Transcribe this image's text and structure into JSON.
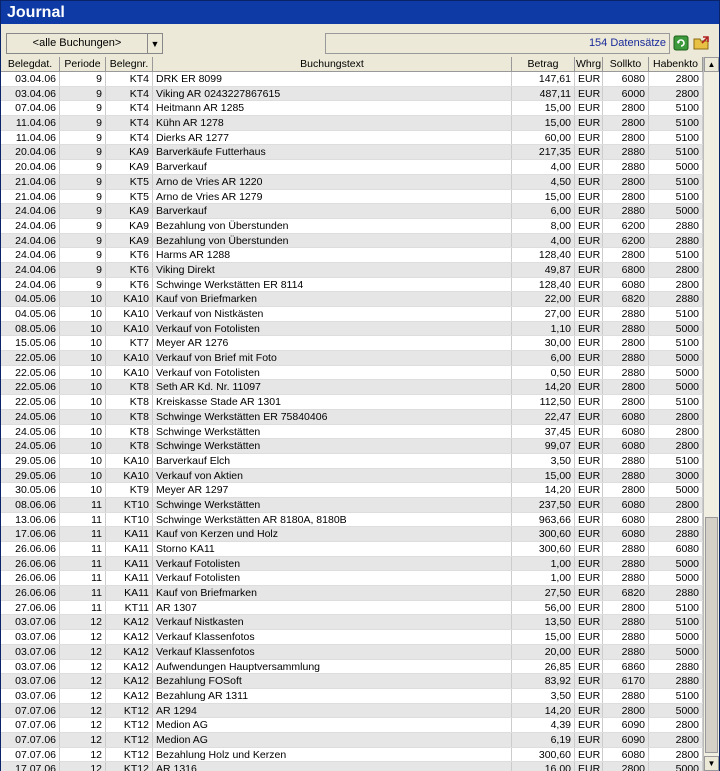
{
  "window": {
    "title": "Journal"
  },
  "toolbar": {
    "filter_value": "<alle Buchungen>",
    "record_count": "154 Datensätze",
    "refresh_icon": "refresh-icon",
    "export_icon": "folder-export-icon"
  },
  "table": {
    "columns": [
      "Belegdat.",
      "Periode",
      "Belegnr.",
      "Buchungstext",
      "Betrag",
      "Whrg",
      "Sollkto",
      "Habenkto"
    ],
    "rows": [
      [
        "03.04.06",
        "9",
        "KT4",
        "DRK ER 8099",
        "147,61",
        "EUR",
        "6080",
        "2800"
      ],
      [
        "03.04.06",
        "9",
        "KT4",
        "Viking AR 0243227867615",
        "487,11",
        "EUR",
        "6000",
        "2800"
      ],
      [
        "07.04.06",
        "9",
        "KT4",
        "Heitmann AR 1285",
        "15,00",
        "EUR",
        "2800",
        "5100"
      ],
      [
        "11.04.06",
        "9",
        "KT4",
        "Kühn AR 1278",
        "15,00",
        "EUR",
        "2800",
        "5100"
      ],
      [
        "11.04.06",
        "9",
        "KT4",
        "Dierks AR 1277",
        "60,00",
        "EUR",
        "2800",
        "5100"
      ],
      [
        "20.04.06",
        "9",
        "KA9",
        "Barverkäufe Futterhaus",
        "217,35",
        "EUR",
        "2880",
        "5100"
      ],
      [
        "20.04.06",
        "9",
        "KA9",
        "Barverkauf",
        "4,00",
        "EUR",
        "2880",
        "5000"
      ],
      [
        "21.04.06",
        "9",
        "KT5",
        "Arno de Vries AR 1220",
        "4,50",
        "EUR",
        "2800",
        "5100"
      ],
      [
        "21.04.06",
        "9",
        "KT5",
        "Arno de Vries AR 1279",
        "15,00",
        "EUR",
        "2800",
        "5100"
      ],
      [
        "24.04.06",
        "9",
        "KA9",
        "Barverkauf",
        "6,00",
        "EUR",
        "2880",
        "5000"
      ],
      [
        "24.04.06",
        "9",
        "KA9",
        "Bezahlung von Überstunden",
        "8,00",
        "EUR",
        "6200",
        "2880"
      ],
      [
        "24.04.06",
        "9",
        "KA9",
        "Bezahlung von Überstunden",
        "4,00",
        "EUR",
        "6200",
        "2880"
      ],
      [
        "24.04.06",
        "9",
        "KT6",
        "Harms AR 1288",
        "128,40",
        "EUR",
        "2800",
        "5100"
      ],
      [
        "24.04.06",
        "9",
        "KT6",
        "Viking Direkt",
        "49,87",
        "EUR",
        "6800",
        "2800"
      ],
      [
        "24.04.06",
        "9",
        "KT6",
        "Schwinge Werkstätten ER 8114",
        "128,40",
        "EUR",
        "6080",
        "2800"
      ],
      [
        "04.05.06",
        "10",
        "KA10",
        "Kauf von Briefmarken",
        "22,00",
        "EUR",
        "6820",
        "2880"
      ],
      [
        "04.05.06",
        "10",
        "KA10",
        "Verkauf von Nistkästen",
        "27,00",
        "EUR",
        "2880",
        "5100"
      ],
      [
        "08.05.06",
        "10",
        "KA10",
        "Verkauf von Fotolisten",
        "1,10",
        "EUR",
        "2880",
        "5000"
      ],
      [
        "15.05.06",
        "10",
        "KT7",
        "Meyer AR 1276",
        "30,00",
        "EUR",
        "2800",
        "5100"
      ],
      [
        "22.05.06",
        "10",
        "KA10",
        "Verkauf von Brief mit Foto",
        "6,00",
        "EUR",
        "2880",
        "5000"
      ],
      [
        "22.05.06",
        "10",
        "KA10",
        "Verkauf von Fotolisten",
        "0,50",
        "EUR",
        "2880",
        "5000"
      ],
      [
        "22.05.06",
        "10",
        "KT8",
        "Seth AR Kd. Nr. 11097",
        "14,20",
        "EUR",
        "2800",
        "5000"
      ],
      [
        "22.05.06",
        "10",
        "KT8",
        "Kreiskasse Stade AR 1301",
        "112,50",
        "EUR",
        "2800",
        "5100"
      ],
      [
        "24.05.06",
        "10",
        "KT8",
        "Schwinge Werkstätten ER 75840406",
        "22,47",
        "EUR",
        "6080",
        "2800"
      ],
      [
        "24.05.06",
        "10",
        "KT8",
        "Schwinge Werkstätten",
        "37,45",
        "EUR",
        "6080",
        "2800"
      ],
      [
        "24.05.06",
        "10",
        "KT8",
        "Schwinge Werkstätten",
        "99,07",
        "EUR",
        "6080",
        "2800"
      ],
      [
        "29.05.06",
        "10",
        "KA10",
        "Barverkauf Elch",
        "3,50",
        "EUR",
        "2880",
        "5100"
      ],
      [
        "29.05.06",
        "10",
        "KA10",
        "Verkauf von Aktien",
        "15,00",
        "EUR",
        "2880",
        "3000"
      ],
      [
        "30.05.06",
        "10",
        "KT9",
        "Meyer AR 1297",
        "14,20",
        "EUR",
        "2800",
        "5000"
      ],
      [
        "08.06.06",
        "11",
        "KT10",
        "Schwinge Werkstätten",
        "237,50",
        "EUR",
        "6080",
        "2800"
      ],
      [
        "13.06.06",
        "11",
        "KT10",
        "Schwinge Werkstätten AR 8180A, 8180B",
        "963,66",
        "EUR",
        "6080",
        "2800"
      ],
      [
        "17.06.06",
        "11",
        "KA11",
        "Kauf von Kerzen und Holz",
        "300,60",
        "EUR",
        "6080",
        "2880"
      ],
      [
        "26.06.06",
        "11",
        "KA11",
        "Storno KA11",
        "300,60",
        "EUR",
        "2880",
        "6080"
      ],
      [
        "26.06.06",
        "11",
        "KA11",
        "Verkauf Fotolisten",
        "1,00",
        "EUR",
        "2880",
        "5000"
      ],
      [
        "26.06.06",
        "11",
        "KA11",
        "Verkauf Fotolisten",
        "1,00",
        "EUR",
        "2880",
        "5000"
      ],
      [
        "26.06.06",
        "11",
        "KA11",
        "Kauf von Briefmarken",
        "27,50",
        "EUR",
        "6820",
        "2880"
      ],
      [
        "27.06.06",
        "11",
        "KT11",
        "AR 1307",
        "56,00",
        "EUR",
        "2800",
        "5100"
      ],
      [
        "03.07.06",
        "12",
        "KA12",
        "Verkauf Nistkasten",
        "13,50",
        "EUR",
        "2880",
        "5100"
      ],
      [
        "03.07.06",
        "12",
        "KA12",
        "Verkauf Klassenfotos",
        "15,00",
        "EUR",
        "2880",
        "5000"
      ],
      [
        "03.07.06",
        "12",
        "KA12",
        "Verkauf Klassenfotos",
        "20,00",
        "EUR",
        "2880",
        "5000"
      ],
      [
        "03.07.06",
        "12",
        "KA12",
        "Aufwendungen Hauptversammlung",
        "26,85",
        "EUR",
        "6860",
        "2880"
      ],
      [
        "03.07.06",
        "12",
        "KA12",
        "Bezahlung FOSoft",
        "83,92",
        "EUR",
        "6170",
        "2880"
      ],
      [
        "03.07.06",
        "12",
        "KA12",
        "Bezahlung AR 1311",
        "3,50",
        "EUR",
        "2880",
        "5100"
      ],
      [
        "07.07.06",
        "12",
        "KT12",
        "AR 1294",
        "14,20",
        "EUR",
        "2800",
        "5000"
      ],
      [
        "07.07.06",
        "12",
        "KT12",
        "Medion AG",
        "4,39",
        "EUR",
        "6090",
        "2800"
      ],
      [
        "07.07.06",
        "12",
        "KT12",
        "Medion AG",
        "6,19",
        "EUR",
        "6090",
        "2800"
      ],
      [
        "07.07.06",
        "12",
        "KT12",
        "Bezahlung Holz und Kerzen",
        "300,60",
        "EUR",
        "6080",
        "2800"
      ],
      [
        "17.07.06",
        "12",
        "KT12",
        "AR 1316",
        "16,00",
        "EUR",
        "2800",
        "5000"
      ]
    ]
  }
}
